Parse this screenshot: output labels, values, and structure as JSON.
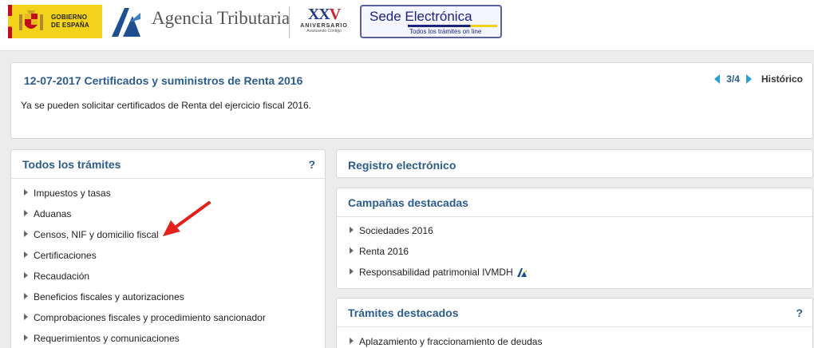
{
  "header": {
    "gobierno": [
      "GOBIERNO",
      "DE ESPAÑA"
    ],
    "agency": "Agencia Tributaria",
    "anniversary": {
      "num_a": "XX",
      "num_b": "V",
      "label": "ANIVERSARIO",
      "sub": "Avanzando Contigo"
    },
    "sede": {
      "title": "Sede Electrónica",
      "subtitle": "Todos los trámites on line"
    }
  },
  "news": {
    "title": "12-07-2017  Certificados y suministros de Renta 2016",
    "body": "Ya se pueden solicitar certificados de Renta del ejercicio fiscal 2016.",
    "pager": "3/4",
    "history": "Histórico"
  },
  "todos": {
    "title": "Todos los trámites",
    "help": "?",
    "items": [
      "Impuestos y tasas",
      "Aduanas",
      "Censos, NIF y domicilio fiscal",
      "Certificaciones",
      "Recaudación",
      "Beneficios fiscales y autorizaciones",
      "Comprobaciones fiscales y procedimiento sancionador",
      "Requerimientos y comunicaciones"
    ]
  },
  "registro": {
    "title": "Registro electrónico"
  },
  "campanas": {
    "title": "Campañas destacadas",
    "items": [
      "Sociedades 2016",
      "Renta 2016",
      "Responsabilidad patrimonial IVMDH"
    ]
  },
  "tramites": {
    "title": "Trámites destacados",
    "help": "?",
    "items": [
      "Aplazamiento y fraccionamiento de deudas"
    ]
  },
  "colors": {
    "link_blue": "#2d5c8c",
    "pager_blue": "#2a9fd8",
    "annotation_red": "#e3201b"
  },
  "icons": [
    "spain-coat-of-arms-icon",
    "aeat-logo-icon",
    "chevron-left-icon",
    "chevron-right-icon",
    "bullet-triangle-icon",
    "aeat-small-icon",
    "red-arrow-annotation"
  ]
}
